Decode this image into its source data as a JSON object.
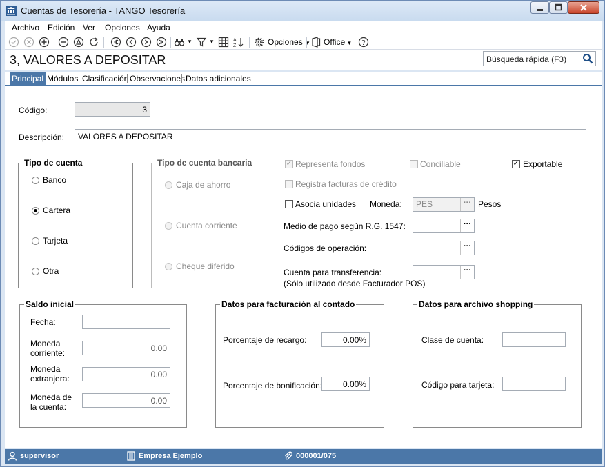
{
  "window": {
    "title": "Cuentas de Tesorería - TANGO Tesorería"
  },
  "menu": [
    {
      "label": "Archivo"
    },
    {
      "label": "Edición"
    },
    {
      "label": "Ver"
    },
    {
      "label": "Opciones"
    },
    {
      "label": "Ayuda"
    }
  ],
  "toolbar": {
    "opciones_label": "Opciones",
    "office_label": "Office"
  },
  "header": {
    "title": "3, VALORES A DEPOSITAR",
    "search_placeholder": "Búsqueda rápida (F3)"
  },
  "tabs": [
    {
      "label": "Principal",
      "active": true
    },
    {
      "label": "Módulos"
    },
    {
      "label": "Clasificación"
    },
    {
      "label": "Observaciones"
    },
    {
      "label": "Datos adicionales"
    }
  ],
  "form": {
    "codigo_label": "Código:",
    "codigo_value": "3",
    "descripcion_label": "Descripción:",
    "descripcion_value": "VALORES A DEPOSITAR",
    "tipo_cuenta": {
      "legend": "Tipo de cuenta",
      "options": [
        "Banco",
        "Cartera",
        "Tarjeta",
        "Otra"
      ],
      "selected": "Cartera"
    },
    "tipo_cuenta_bancaria": {
      "legend": "Tipo de cuenta bancaria",
      "options": [
        "Caja de ahorro",
        "Cuenta corriente",
        "Cheque diferido"
      ]
    },
    "representa_fondos": {
      "label": "Representa fondos",
      "checked": true,
      "enabled": false
    },
    "conciliable": {
      "label": "Conciliable",
      "checked": false,
      "enabled": false
    },
    "exportable": {
      "label": "Exportable",
      "checked": true,
      "enabled": true
    },
    "registra_facturas": {
      "label": "Registra facturas de crédito",
      "checked": false,
      "enabled": false
    },
    "asocia_unidades": {
      "label": "Asocia unidades",
      "checked": false,
      "enabled": true
    },
    "moneda_label": "Moneda:",
    "moneda_value": "PES",
    "moneda_desc": "Pesos",
    "medio_pago_label": "Medio de pago según R.G. 1547:",
    "codigos_operacion_label": "Códigos de operación:",
    "cuenta_transferencia_label": "Cuenta para transferencia:",
    "cuenta_transferencia_note": "(Sólo utilizado desde Facturador POS)",
    "saldo_inicial": {
      "legend": "Saldo inicial",
      "fecha_label": "Fecha:",
      "moneda_corriente_label": [
        "Moneda",
        "corriente:"
      ],
      "moneda_corriente_value": "0.00",
      "moneda_extranjera_label": [
        "Moneda",
        "extranjera:"
      ],
      "moneda_extranjera_value": "0.00",
      "moneda_cuenta_label": [
        "Moneda de",
        "la cuenta:"
      ],
      "moneda_cuenta_value": "0.00"
    },
    "facturacion": {
      "legend": "Datos para facturación al contado",
      "recargo_label": "Porcentaje de recargo:",
      "recargo_value": "0.00%",
      "bonificacion_label": "Porcentaje de bonificación:",
      "bonificacion_value": "0.00%"
    },
    "shopping": {
      "legend": "Datos para archivo shopping",
      "clase_label": "Clase de cuenta:",
      "codigo_tarjeta_label": "Código para tarjeta:"
    }
  },
  "status": {
    "user": "supervisor",
    "company": "Empresa Ejemplo",
    "code": "000001/075"
  }
}
